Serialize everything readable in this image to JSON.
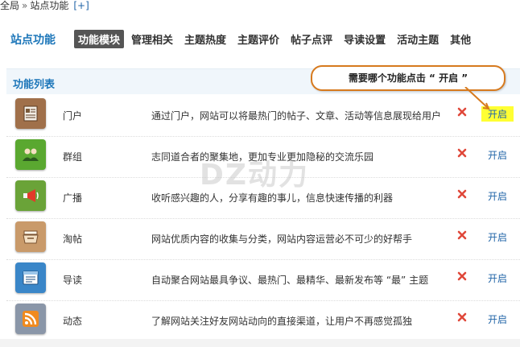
{
  "breadcrumb": {
    "root": "全局",
    "separator": "»",
    "current": "站点功能",
    "add": "[+]"
  },
  "header": {
    "title": "站点功能",
    "tabs": [
      {
        "label": "功能模块",
        "active": true
      },
      {
        "label": "管理相关",
        "active": false
      },
      {
        "label": "主题热度",
        "active": false
      },
      {
        "label": "主题评价",
        "active": false
      },
      {
        "label": "帖子点评",
        "active": false
      },
      {
        "label": "导读设置",
        "active": false
      },
      {
        "label": "活动主题",
        "active": false
      },
      {
        "label": "其他",
        "active": false
      }
    ]
  },
  "section": {
    "label": "功能列表"
  },
  "callout": {
    "text": "需要哪个功能点击 “ 开启 ”"
  },
  "modules": [
    {
      "name": "门户",
      "description": "通过门户，网站可以将最热门的帖子、文章、活动等信息展现给用户",
      "action": "开启",
      "icon": "portal-icon",
      "color": "#a0704a",
      "highlight": true
    },
    {
      "name": "群组",
      "description": "志同道合者的聚集地，更加专业更加隐秘的交流乐园",
      "action": "开启",
      "icon": "group-icon",
      "color": "#5aa830",
      "highlight": false
    },
    {
      "name": "广播",
      "description": "收听感兴趣的人，分享有趣的事儿，信息快速传播的利器",
      "action": "开启",
      "icon": "broadcast-icon",
      "color": "#6aa338",
      "highlight": false
    },
    {
      "name": "淘帖",
      "description": "网站优质内容的收集与分类，网站内容运营必不可少的好帮手",
      "action": "开启",
      "icon": "collection-icon",
      "color": "#c99a6a",
      "highlight": false
    },
    {
      "name": "导读",
      "description": "自动聚合网站最具争议、最热门、最精华、最新发布等 “最” 主题",
      "action": "开启",
      "icon": "guide-icon",
      "color": "#3a86c8",
      "highlight": false
    },
    {
      "name": "动态",
      "description": "了解网站关注好友网站动向的直接渠道，让用户不再感觉孤独",
      "action": "开启",
      "icon": "feed-icon",
      "color": "#8a96a8",
      "highlight": false
    }
  ],
  "watermark": {
    "text": "DZ动力"
  }
}
